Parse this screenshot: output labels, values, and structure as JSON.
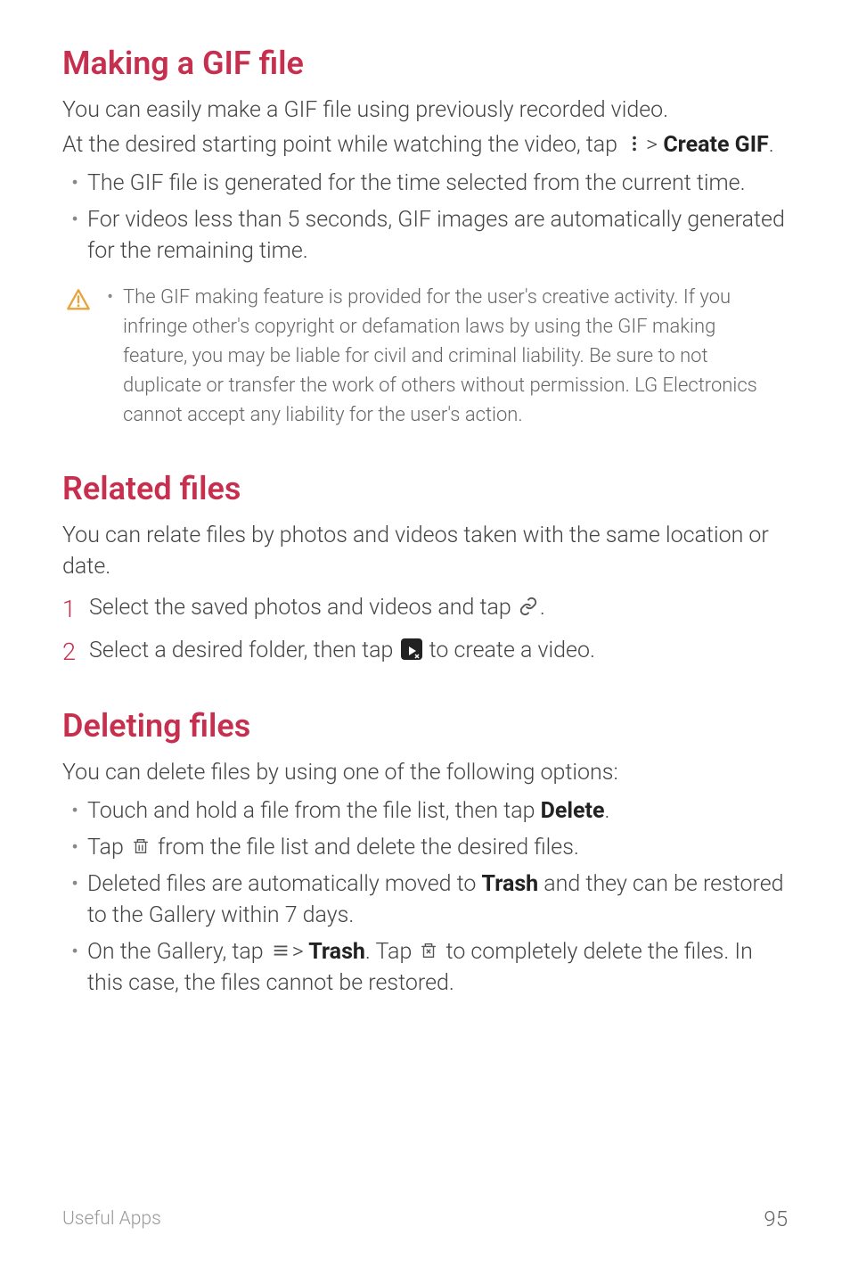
{
  "section1": {
    "title": "Making a GIF file",
    "p1": "You can easily make a GIF file using previously recorded video.",
    "p2_a": "At the desired starting point while watching the video, tap ",
    "p2_b": " ",
    "p2_sep": ">",
    "p2_bold": " Create GIF",
    "p2_end": ".",
    "bullets": [
      "The GIF file is generated for the time selected from the current time.",
      "For videos less than 5 seconds, GIF images are automatically generated for the remaining time."
    ],
    "warning": "The GIF making feature is provided for the user's creative activity. If you infringe other's copyright or defamation laws by using the GIF making feature, you may be liable for civil and criminal liability. Be sure to not duplicate or transfer the work of others without permission. LG Electronics cannot accept any liability for the user's action."
  },
  "section2": {
    "title": "Related files",
    "p1": "You can relate files by photos and videos taken with the same location or date.",
    "steps": {
      "s1": "Select the saved photos and videos and tap ",
      "s1_end": ".",
      "s2_a": "Select a desired folder, then tap ",
      "s2_b": " to create a video."
    }
  },
  "section3": {
    "title": "Deleting files",
    "p1": "You can delete files by using one of the following options:",
    "b1_a": "Touch and hold a file from the file list, then tap ",
    "b1_bold": "Delete",
    "b1_end": ".",
    "b2_a": "Tap ",
    "b2_b": " from the file list and delete the desired files.",
    "b3_a": "Deleted files are automatically moved to ",
    "b3_bold": "Trash",
    "b3_b": " and they can be restored to the Gallery within 7 days.",
    "b4_a": "On the Gallery, tap ",
    "b4_sep": ">",
    "b4_bold": " Trash",
    "b4_b": ". Tap ",
    "b4_c": " to completely delete the files. In this case, the files cannot be restored."
  },
  "footer": {
    "section": "Useful Apps",
    "page": "95"
  }
}
